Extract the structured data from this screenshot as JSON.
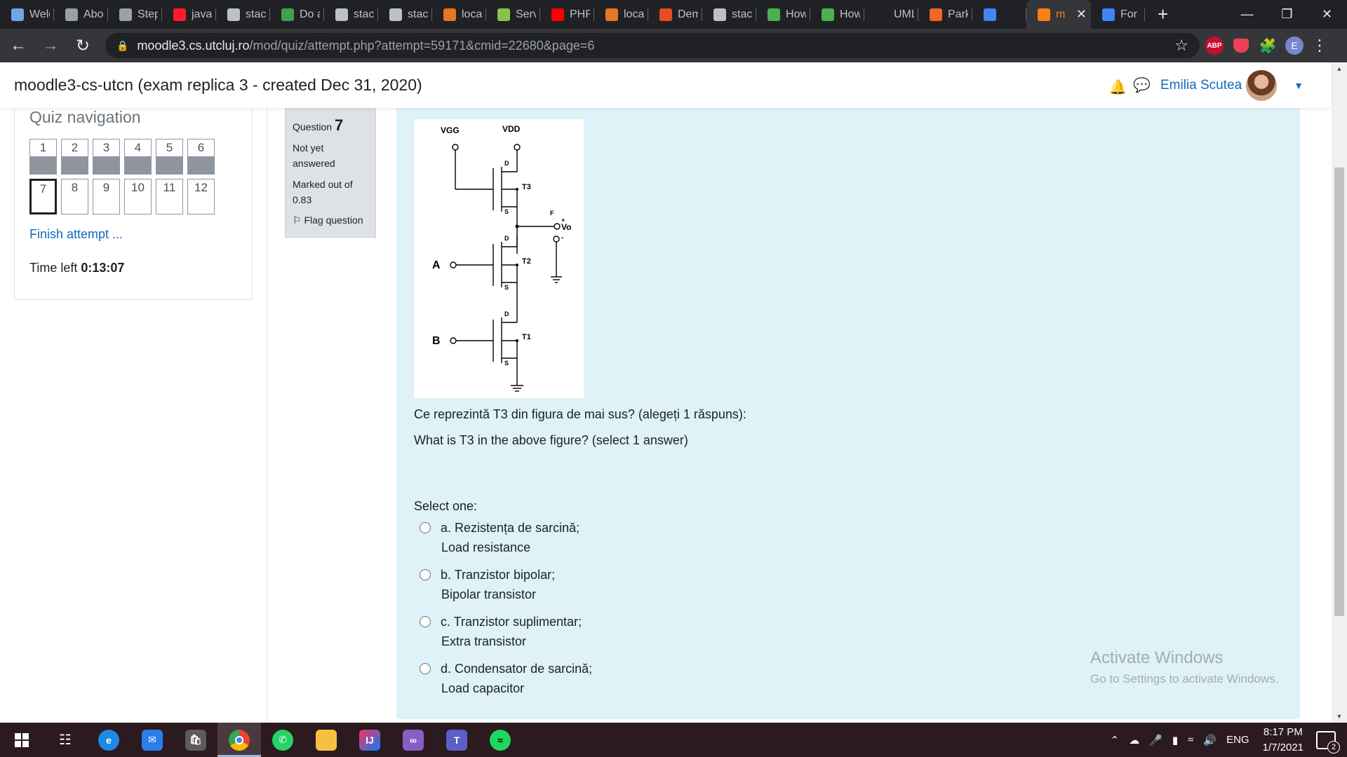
{
  "browser": {
    "tabs": [
      {
        "label": "Welc",
        "icon": "cube-icon",
        "color": "#6ea6e8"
      },
      {
        "label": "Abo",
        "icon": "globe-icon",
        "color": "#9aa0a6"
      },
      {
        "label": "Step",
        "icon": "globe-icon",
        "color": "#9aa0a6"
      },
      {
        "label": "java",
        "icon": "opera-icon",
        "color": "#ff1b2d"
      },
      {
        "label": "stac",
        "icon": "stackoverflow-icon",
        "color": "#bdc1c6"
      },
      {
        "label": "Do a",
        "icon": "document-icon",
        "color": "#3fa34d"
      },
      {
        "label": "stac",
        "icon": "stackoverflow-icon",
        "color": "#bdc1c6"
      },
      {
        "label": "stac",
        "icon": "stackoverflow-icon",
        "color": "#bdc1c6"
      },
      {
        "label": "loca",
        "icon": "xampp-icon",
        "color": "#e87722"
      },
      {
        "label": "Serv",
        "icon": "bookmark-icon",
        "color": "#8bc34a"
      },
      {
        "label": "PHP",
        "icon": "youtube-icon",
        "color": "#ff0000"
      },
      {
        "label": "loca",
        "icon": "xampp-icon",
        "color": "#e87722"
      },
      {
        "label": "Dem",
        "icon": "w3-icon",
        "color": "#e44d26"
      },
      {
        "label": "stac",
        "icon": "stackoverflow-icon",
        "color": "#bdc1c6"
      },
      {
        "label": "How",
        "icon": "w3schools-icon",
        "color": "#4caf50"
      },
      {
        "label": "How",
        "icon": "w3schools-icon",
        "color": "#4caf50"
      },
      {
        "label": "UML",
        "icon": "jetbrains-icon",
        "color": "#202124"
      },
      {
        "label": "Park",
        "icon": "puzzle-icon",
        "color": "#f26522"
      },
      {
        "label": "",
        "icon": "recording-icon",
        "color": "#4285f4"
      }
    ],
    "active_tab": {
      "label": "m",
      "icon": "moodle-icon",
      "color": "#f98012"
    },
    "last_tab": {
      "label": "For",
      "icon": "google-icon",
      "color": "#4285f4"
    },
    "url_host": "moodle3.cs.utcluj.ro",
    "url_path": "/mod/quiz/attempt.php?attempt=59171&cmid=22680&page=6",
    "profile_initial": "E",
    "abp_label": "ABP"
  },
  "site": {
    "title": "moodle3-cs-utcn (exam replica 3 - created Dec 31, 2020)",
    "user_name": "Emilia Scutea"
  },
  "quiz_nav": {
    "title": "Quiz navigation",
    "questions": [
      {
        "n": "1",
        "answered": true
      },
      {
        "n": "2",
        "answered": true
      },
      {
        "n": "3",
        "answered": true
      },
      {
        "n": "4",
        "answered": true
      },
      {
        "n": "5",
        "answered": true
      },
      {
        "n": "6",
        "answered": true
      },
      {
        "n": "7",
        "answered": false,
        "current": true
      },
      {
        "n": "8",
        "answered": false
      },
      {
        "n": "9",
        "answered": false
      },
      {
        "n": "10",
        "answered": false
      },
      {
        "n": "11",
        "answered": false
      },
      {
        "n": "12",
        "answered": false
      }
    ],
    "finish_label": "Finish attempt ...",
    "time_label": "Time left",
    "time_value": "0:13:07"
  },
  "question": {
    "label": "Question",
    "number": "7",
    "state": "Not yet answered",
    "grade": "Marked out of 0.83",
    "flag_label": "Flag question",
    "text_ro": "Ce reprezintă T3 din figura de mai sus? (alegeți 1 răspuns):",
    "text_en": "What is T3 in the above figure? (select 1 answer)",
    "prompt": "Select one:",
    "answers": [
      {
        "ro": "a. Rezistența de sarcină;",
        "en": "Load resistance"
      },
      {
        "ro": "b. Tranzistor bipolar;",
        "en": "Bipolar transistor"
      },
      {
        "ro": "c. Tranzistor suplimentar;",
        "en": "Extra transistor"
      },
      {
        "ro": "d. Condensator de sarcină;",
        "en": "Load capacitor"
      }
    ],
    "figure": {
      "vgg": "VGG",
      "vdd": "VDD",
      "vo": "Vo",
      "t1": "T1",
      "t2": "T2",
      "t3": "T3",
      "a": "A",
      "b": "B",
      "d": "D",
      "s": "S",
      "f": "F",
      "plus": "+",
      "minus": "-"
    }
  },
  "watermark": {
    "line1": "Activate Windows",
    "line2": "Go to Settings to activate Windows."
  },
  "taskbar": {
    "lang": "ENG",
    "time": "8:17 PM",
    "date": "1/7/2021",
    "notifications": "2"
  }
}
